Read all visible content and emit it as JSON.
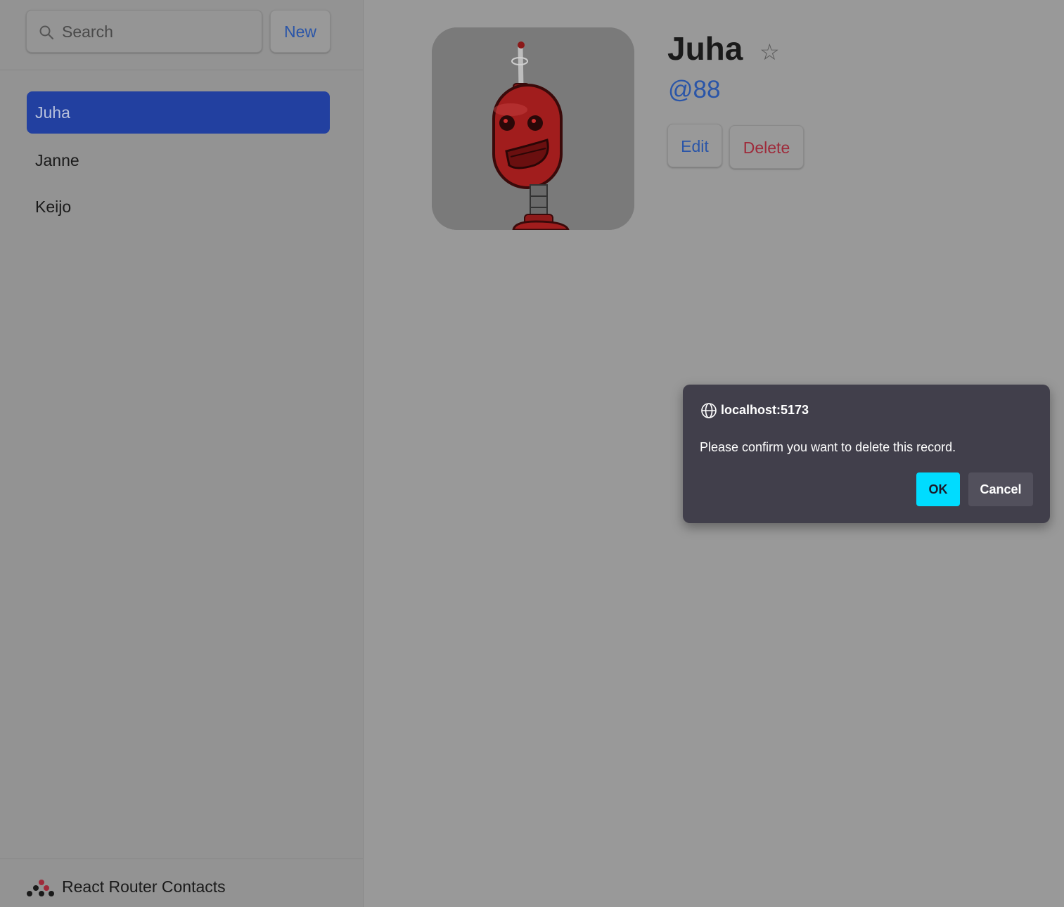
{
  "sidebar": {
    "search": {
      "placeholder": "Search",
      "value": ""
    },
    "new_button": "New",
    "contacts": [
      {
        "name": "Juha",
        "active": true
      },
      {
        "name": "Janne",
        "active": false
      },
      {
        "name": "Keijo",
        "active": false
      }
    ],
    "footer": {
      "title": "React Router Contacts"
    }
  },
  "contact": {
    "name": "Juha",
    "handle": "@88",
    "favorite": false,
    "avatar": "red-robot-avatar",
    "edit_label": "Edit",
    "delete_label": "Delete"
  },
  "dialog": {
    "origin": "localhost:5173",
    "message": "Please confirm you want to delete this record.",
    "ok_label": "OK",
    "cancel_label": "Cancel"
  },
  "icons": {
    "search": "search-icon",
    "star": "star-outline-icon",
    "globe": "globe-icon",
    "logo": "react-router-logo"
  },
  "colors": {
    "accent": "#2a55a8",
    "active_item": "#2240a0",
    "danger": "#9e2a3a",
    "dialog_bg": "#413f4b",
    "dialog_ok": "#00dcff"
  }
}
